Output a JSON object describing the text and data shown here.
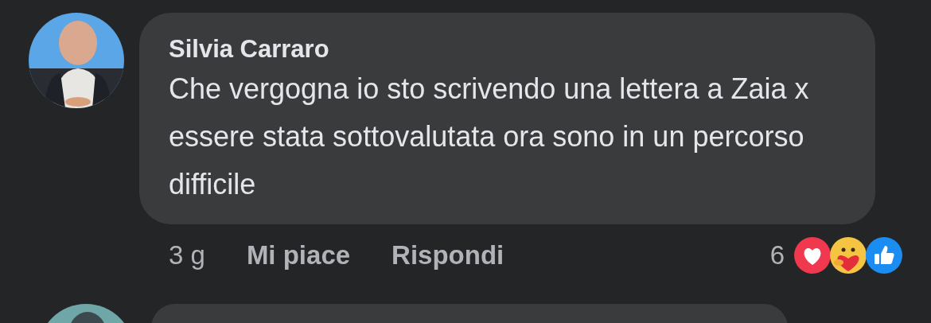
{
  "comments": [
    {
      "avatar": {
        "kind": "picture"
      },
      "author": "Silvia Carraro",
      "text": "Che vergogna io sto scrivendo una lettera a Zaia x essere stata sottovalutata ora sono in un percorso difficile",
      "time": "3 g",
      "actions": [
        "Mi piace",
        "Rispondi"
      ],
      "reaction_count": "6"
    },
    {
      "avatar": {
        "kind": "picture"
      }
    }
  ]
}
